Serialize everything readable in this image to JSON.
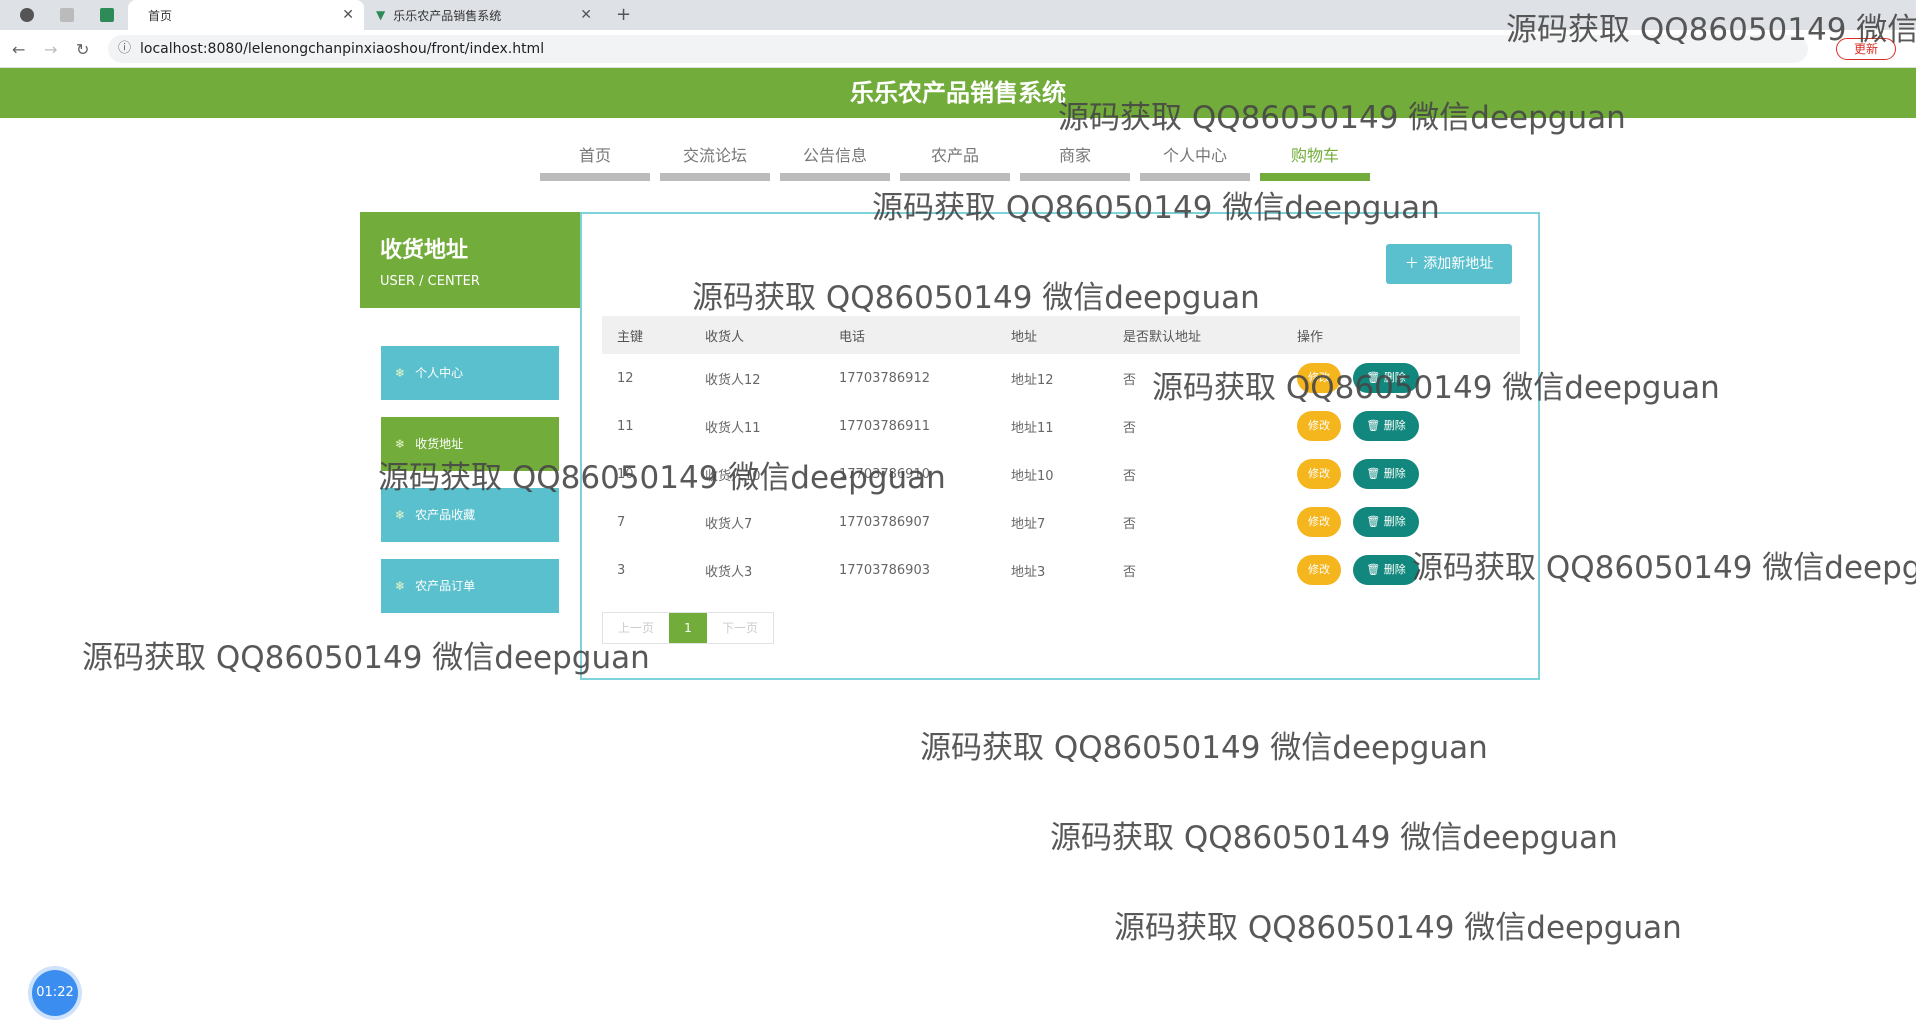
{
  "browser": {
    "tabs": [
      {
        "label": "首页"
      },
      {
        "label": "乐乐农产品销售系统"
      }
    ],
    "url": "localhost:8080/lelenongchanpinxiaoshou/front/index.html",
    "update_label": "更新"
  },
  "site": {
    "title": "乐乐农产品销售系统"
  },
  "nav": {
    "items": [
      "首页",
      "交流论坛",
      "公告信息",
      "农产品",
      "商家",
      "个人中心",
      "购物车"
    ],
    "active": "购物车"
  },
  "sidebar": {
    "title": "收货地址",
    "subtitle": "USER / CENTER",
    "items": [
      "个人中心",
      "收货地址",
      "农产品收藏",
      "农产品订单"
    ],
    "active": "收货地址"
  },
  "main": {
    "add_button": "添加新地址",
    "columns": [
      "主键",
      "收货人",
      "电话",
      "地址",
      "是否默认地址",
      "操作"
    ],
    "rows": [
      {
        "id": "12",
        "name": "收货人12",
        "phone": "17703786912",
        "address": "地址12",
        "default": "否"
      },
      {
        "id": "11",
        "name": "收货人11",
        "phone": "17703786911",
        "address": "地址11",
        "default": "否"
      },
      {
        "id": "10",
        "name": "收货人10",
        "phone": "17703786910",
        "address": "地址10",
        "default": "否"
      },
      {
        "id": "7",
        "name": "收货人7",
        "phone": "17703786907",
        "address": "地址7",
        "default": "否"
      },
      {
        "id": "3",
        "name": "收货人3",
        "phone": "17703786903",
        "address": "地址3",
        "default": "否"
      }
    ],
    "edit_label": "修改",
    "delete_label": "删除",
    "pager": {
      "prev": "上一页",
      "current": "1",
      "next": "下一页"
    }
  },
  "watermark": "源码获取 QQ86050149 微信deepguan",
  "timer": "01:22",
  "colors": {
    "brand_green": "#72ac3a",
    "teal": "#5bc0cd",
    "edit": "#f5b51d",
    "delete": "#12877d"
  }
}
